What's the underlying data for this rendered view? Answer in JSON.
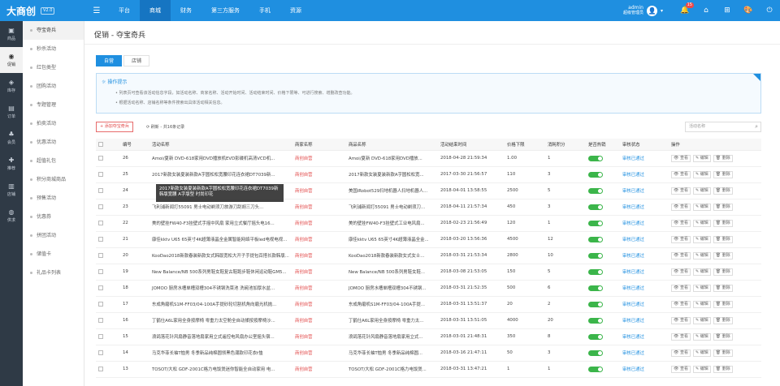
{
  "app": {
    "logo": "大商创",
    "version": "V2.0"
  },
  "nav": [
    {
      "label": "平台",
      "active": false
    },
    {
      "label": "商城",
      "active": true
    },
    {
      "label": "财务",
      "active": false
    },
    {
      "label": "第三方服务",
      "active": false
    },
    {
      "label": "手机",
      "active": false
    },
    {
      "label": "资源",
      "active": false
    }
  ],
  "user": {
    "name": "admin",
    "role": "超级管理员",
    "avatar": "👤",
    "notice_count": "15"
  },
  "icons": {
    "menu": "☰",
    "bell": "🔔",
    "home": "⌂",
    "sitemap": "⊞",
    "palette": "🎨",
    "power": "⏻",
    "caret": "▾",
    "search": "⌕",
    "refresh": "⟳",
    "bulb": "☼",
    "view": "👁",
    "edit": "✎",
    "delete": "🗑"
  },
  "rail": [
    {
      "label": "商品",
      "icon": "▣",
      "active": false
    },
    {
      "label": "促销",
      "icon": "◉",
      "active": true
    },
    {
      "label": "库存",
      "icon": "◈",
      "active": false
    },
    {
      "label": "订单",
      "icon": "▤",
      "active": false
    },
    {
      "label": "会员",
      "icon": "♣",
      "active": false
    },
    {
      "label": "推荐",
      "icon": "✚",
      "active": false
    },
    {
      "label": "店铺",
      "icon": "▥",
      "active": false
    },
    {
      "label": "供求",
      "icon": "◍",
      "active": false
    }
  ],
  "sidebar": [
    {
      "label": "夺宝奇兵",
      "active": true
    },
    {
      "label": "秒杀活动",
      "active": false
    },
    {
      "label": "红包类型",
      "active": false
    },
    {
      "label": "团购活动",
      "active": false
    },
    {
      "label": "专题管理",
      "active": false
    },
    {
      "label": "拍卖活动",
      "active": false
    },
    {
      "label": "优惠活动",
      "active": false
    },
    {
      "label": "超值礼包",
      "active": false
    },
    {
      "label": "积分商城商品",
      "active": false
    },
    {
      "label": "预售活动",
      "active": false
    },
    {
      "label": "优惠券",
      "active": false
    },
    {
      "label": "拼团活动",
      "active": false
    },
    {
      "label": "储值卡",
      "active": false
    },
    {
      "label": "礼品卡列表",
      "active": false
    }
  ],
  "page": {
    "title": "促销 - 夺宝奇兵"
  },
  "tabs": [
    {
      "label": "自营",
      "active": true
    },
    {
      "label": "店铺",
      "active": false
    }
  ],
  "tips": {
    "title": "操作提示",
    "lines": [
      "列表页可查看该活动信息字段，如活动名称、商家名称、活动开始时间、活动结束时间、价格下限等、可进行搜索、增删改查功能。",
      "根据活动名称、店铺名称等条件搜索出具体活动相关信息。"
    ]
  },
  "toolbar": {
    "add_label": "+ 添加夺宝奇兵",
    "refresh_label": "刷新 - 共16条记录",
    "search_placeholder": "活动名称"
  },
  "table": {
    "headers": [
      "",
      "编号",
      "活动名称",
      "商家名称",
      "商品名称",
      "活动结束时间",
      "价格下限",
      "消耗积分",
      "是否热销",
      "审核状态",
      "操作"
    ],
    "actions": {
      "view": "查看",
      "edit": "编辑",
      "delete": "删除"
    },
    "rows": [
      {
        "id": "26",
        "name": "Amoi/夏新 DVD-618家用DVD播放机EVD影碟机高清VCD机...",
        "shop": "商创自营",
        "goods": "Amoi/夏新 DVD-618家用DVD播放...",
        "end": "2018-04-28 21:59:34",
        "price": "1.00",
        "points": "1",
        "status": "审核已通过"
      },
      {
        "id": "25",
        "name": "2017新款女装夏装新款A字圆松松宽腰印花连衣裙DT7039新...",
        "shop": "商创自营",
        "goods": "2017新款女装夏装新款A字圆松松宽...",
        "end": "2017-03-30 21:56:57",
        "price": "110",
        "points": "3",
        "status": "审核已通过"
      },
      {
        "id": "24",
        "name": "",
        "shop": "商创自营",
        "goods": "美国iRobot529扫地机器人扫地机器人...",
        "end": "2018-04-01 13:58:55",
        "price": "2500",
        "points": "5",
        "status": "审核已通过"
      },
      {
        "id": "23",
        "name": "飞利浦新闻打55091 男士电动剃须刀旅游刀刮胡三刀头...",
        "shop": "商创自营",
        "goods": "飞利浦新闻打55091 男士电动剃须刀...",
        "end": "2018-04-11 21:57:34",
        "price": "450",
        "points": "3",
        "status": "审核已通过"
      },
      {
        "id": "22",
        "name": "美的壁挂FW40-F3挂壁式手摇中风扇 家用立式餐厅摇头电16...",
        "shop": "商创自营",
        "goods": "美的壁挂FW40-F3挂壁式工业电风扇...",
        "end": "2018-02-23 21:56:49",
        "price": "120",
        "points": "1",
        "status": "审核已通过"
      },
      {
        "id": "21",
        "name": "康佳kktv U65 65英寸4K超薄液晶全金属智能网络平板led电视电视...",
        "shop": "商创自营",
        "goods": "康佳kktv U65 65英寸4K超薄液晶全金...",
        "end": "2018-03-20 13:56:36",
        "price": "4500",
        "points": "12",
        "status": "审核已通过"
      },
      {
        "id": "20",
        "name": "KooDao2018新款春装新款女式韩版宽松大开子手提包百搭长款韩版...",
        "shop": "商创自营",
        "goods": "KooDao2018新款春装新款女式女士...",
        "end": "2018-03-31 21:53:34",
        "price": "2800",
        "points": "10",
        "status": "审核已通过"
      },
      {
        "id": "19",
        "name": "New Balance/NB 500系列男鞋女鞋复古鞋跑步鞋休闲运动鞋GM5...",
        "shop": "商创自营",
        "goods": "New Balance/NB 500系列男鞋女鞋...",
        "end": "2018-03-08 21:53:05",
        "price": "150",
        "points": "5",
        "status": "审核已通过"
      },
      {
        "id": "18",
        "name": "JOMOO 厨房水槽单槽双槽304不锈钢洗菜池 洗碗池加厚水盆...",
        "shop": "商创自营",
        "goods": "JOMOO 厨房水槽单槽双槽304不锈钢...",
        "end": "2018-03-31 21:52:35",
        "price": "500",
        "points": "6",
        "status": "审核已通过"
      },
      {
        "id": "17",
        "name": "东成角磨机S1M-FF03/04-100A手提砂轮切割机角向磨光机抛...",
        "shop": "商创自营",
        "goods": "东成角磨机S1M-FF03/04-100A手提...",
        "end": "2018-03-31 13:51:37",
        "price": "20",
        "points": "2",
        "status": "审核已通过"
      },
      {
        "id": "16",
        "name": "丁鹤仕A6L家用全身按摩椅 零重力太空舱全自动揉按按摩椅沙...",
        "shop": "商创自营",
        "goods": "丁鹤仕A6L家用全身按摩椅 零重力太...",
        "end": "2018-03-31 13:51:05",
        "price": "4000",
        "points": "20",
        "status": "审核已通过"
      },
      {
        "id": "15",
        "name": "浪鸽落花针风扇静音落地扇家用立式遥控电风扇办公室摇头宿...",
        "shop": "商创自营",
        "goods": "浪鸽落花针风扇静音落地扇家用立式...",
        "end": "2018-03-01 21:48:31",
        "price": "350",
        "points": "8",
        "status": "审核已通过"
      },
      {
        "id": "14",
        "name": "马克华菲长袖T恤男 冬季新品纯棉圆领黑色潮款印花衣t恤",
        "shop": "商创自营",
        "goods": "马克华菲长袖T恤男 冬季新品纯棉圆...",
        "end": "2018-03-16 21:47:11",
        "price": "50",
        "points": "3",
        "status": "审核已通过"
      },
      {
        "id": "13",
        "name": "TOSOT/大松 GDF-2001C格力电饭煲迷你智能全自动家用 电...",
        "shop": "商创自营",
        "goods": "TOSOT/大松 GDF-2001C格力电饭煲...",
        "end": "2018-03-31 13:47:21",
        "price": "1",
        "points": "1",
        "status": "审核已通过"
      }
    ]
  },
  "tooltip": {
    "text": "2017新款女装夏装新款A字圆松松宽腰印花连衣裙DT7039新 韩版宽腰 A字版型 时尚印花"
  },
  "colors": {
    "accent": "#1f8fe0",
    "danger": "#e14848",
    "success": "#3bb54a"
  }
}
